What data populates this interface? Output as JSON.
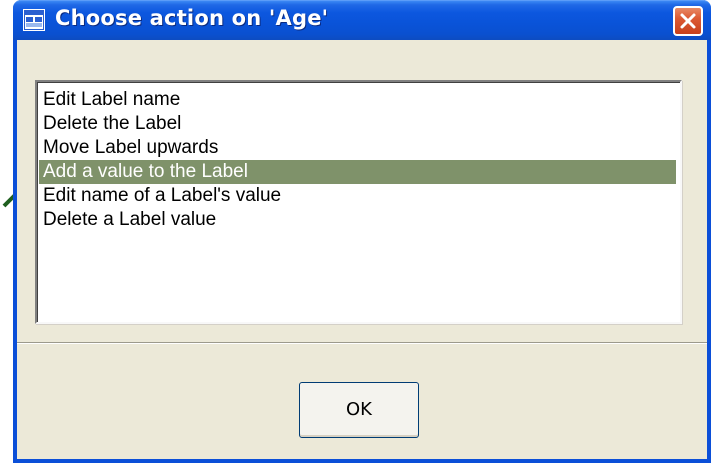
{
  "window": {
    "title": "Choose action on 'Age'",
    "icon": "window-app-icon",
    "close_icon": "close-icon",
    "titlebar_color": "#0a53d8",
    "close_color": "#dc5a34"
  },
  "list": {
    "items": [
      {
        "label": "Edit Label name",
        "selected": false
      },
      {
        "label": "Delete the Label",
        "selected": false
      },
      {
        "label": "Move Label upwards",
        "selected": false
      },
      {
        "label": "Add a value to the Label",
        "selected": true
      },
      {
        "label": "Edit name of a Label's value",
        "selected": false
      },
      {
        "label": "Delete a Label value",
        "selected": false
      }
    ],
    "selection_color": "#7f926a"
  },
  "buttons": {
    "ok_label": "OK"
  },
  "annotation": {
    "arrow_icon": "pointer-arrow-icon",
    "arrow_color": "#1f5f1f"
  }
}
